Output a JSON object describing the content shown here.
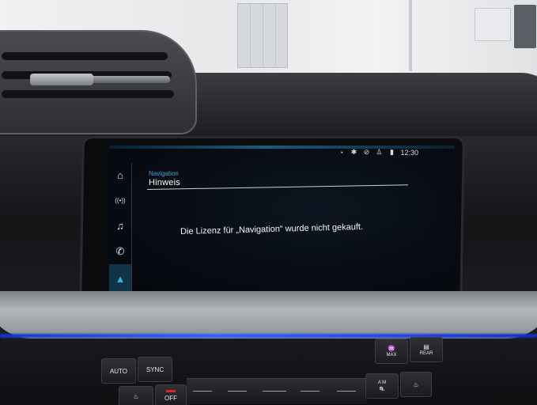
{
  "screen": {
    "status": {
      "time": "12:30",
      "icons": [
        "voice-icon",
        "bluetooth-icon",
        "no-navigation-icon",
        "user-icon",
        "signal-icon"
      ]
    },
    "sidebar": [
      {
        "name": "home",
        "icon": "⌂"
      },
      {
        "name": "radio",
        "icon": "((•))"
      },
      {
        "name": "media",
        "icon": "♫"
      },
      {
        "name": "phone",
        "icon": "✆"
      },
      {
        "name": "navigation",
        "icon": "▲"
      }
    ],
    "active_app": "navigation",
    "app_label": "Navigation",
    "page_title": "Hinweis",
    "message": "Die Lizenz für „Navigation“ wurde nicht gekauft.",
    "accent": "#2fb1e6"
  },
  "climate": {
    "auto_label": "AUTO",
    "sync_label": "SYNC",
    "off_label": "OFF",
    "max_label": "MAX",
    "rear_label": "REAR",
    "am_label": "A M"
  }
}
